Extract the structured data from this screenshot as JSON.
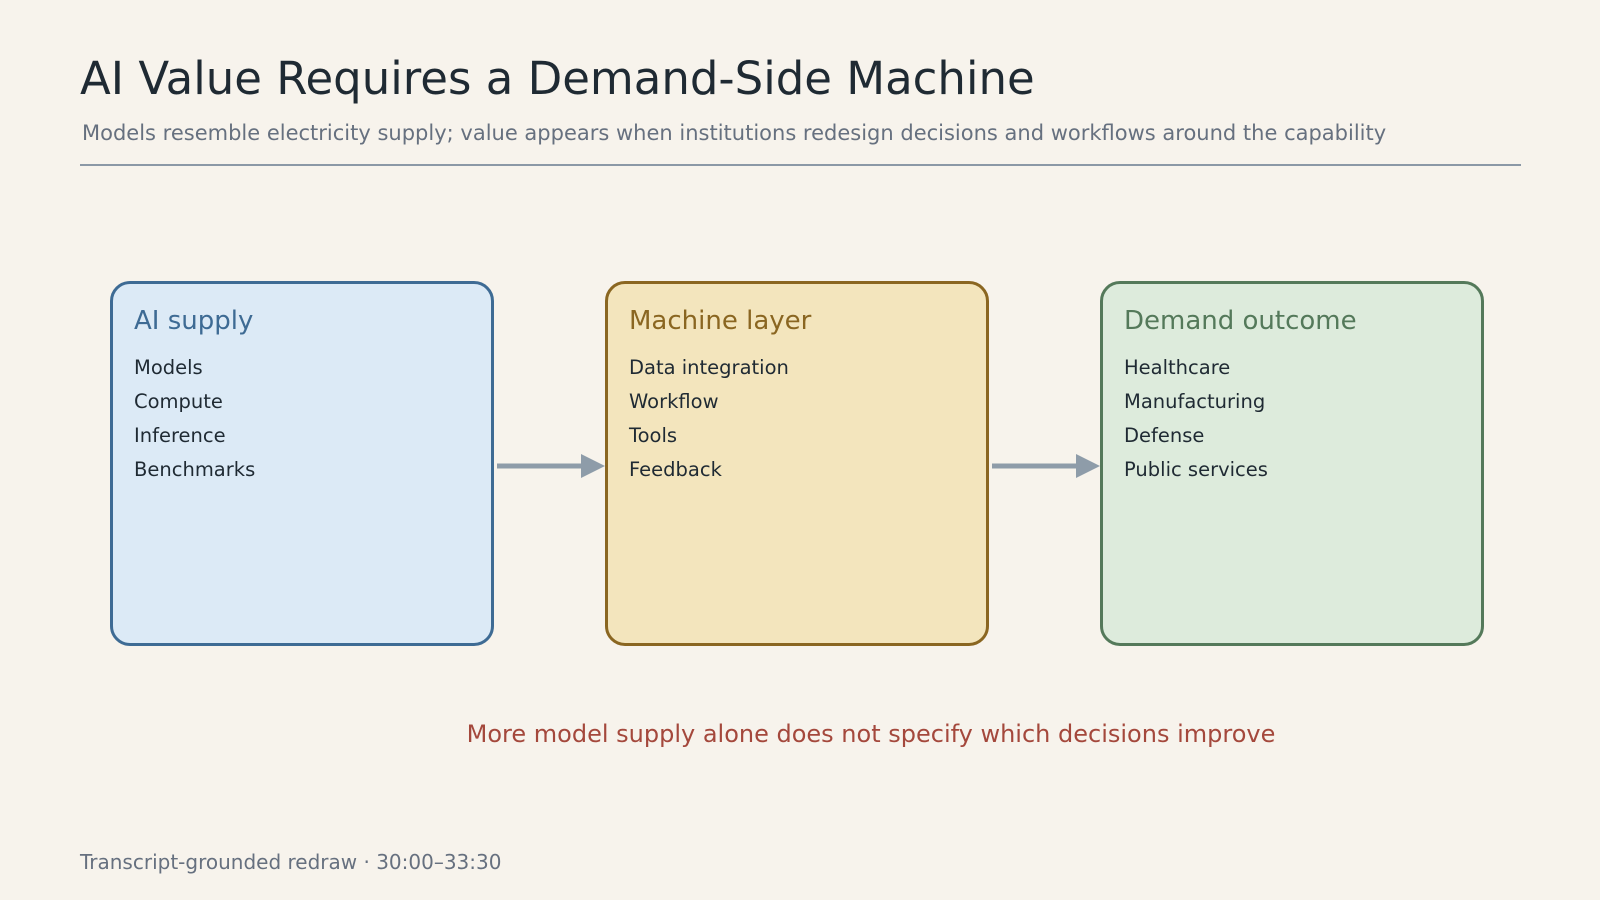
{
  "header": {
    "title": "AI Value Requires a Demand-Side Machine",
    "subtitle": "Models resemble electricity supply; value appears when institutions redesign decisions and workflows around the capability"
  },
  "boxes": [
    {
      "title": "AI supply",
      "items": [
        "Models",
        "Compute",
        "Inference",
        "Benchmarks"
      ],
      "color": "#3e6b94",
      "fill": "#dceaf6"
    },
    {
      "title": "Machine layer",
      "items": [
        "Data integration",
        "Workflow",
        "Tools",
        "Feedback"
      ],
      "color": "#8a6621",
      "fill": "#f3e5bd"
    },
    {
      "title": "Demand outcome",
      "items": [
        "Healthcare",
        "Manufacturing",
        "Defense",
        "Public services"
      ],
      "color": "#54795a",
      "fill": "#ddebdc"
    }
  ],
  "arrow_color": "#8e9ca9",
  "caption": "More model supply alone does not specify which decisions improve",
  "caption_color": "#a4483c",
  "footer": "Transcript-grounded redraw · 30:00–33:30"
}
